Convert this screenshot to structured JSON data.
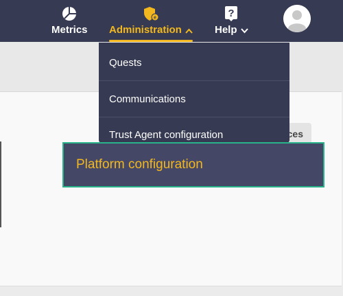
{
  "nav": {
    "items": [
      {
        "label": "Metrics",
        "icon": "pie-chart-icon"
      },
      {
        "label": "Administration",
        "icon": "shield-admin-icon",
        "active": true,
        "chevron": "chevron-up-icon"
      },
      {
        "label": "Help",
        "icon": "question-mark-icon",
        "chevron": "chevron-down-icon"
      }
    ],
    "avatar_icon": "user-avatar-icon"
  },
  "dropdown": {
    "items": [
      {
        "label": "Quests"
      },
      {
        "label": "Communications"
      },
      {
        "label": "Trust Agent configuration"
      }
    ],
    "highlighted": {
      "label": "Platform configuration"
    }
  },
  "card": {
    "button_label": "ces"
  },
  "colors": {
    "navbar": "#363a52",
    "accent": "#f3b81f",
    "highlight_border": "#29b38a",
    "highlight_bg": "#454766"
  }
}
